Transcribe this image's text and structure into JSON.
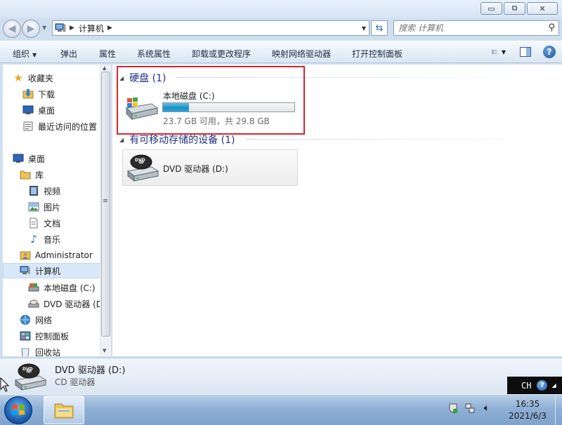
{
  "window": {
    "caption_buttons": {
      "minimize": "▭",
      "maximize": "⧉",
      "close": "✕"
    }
  },
  "address": {
    "crumbs": [
      "计算机"
    ],
    "search_placeholder": "搜索 计算机"
  },
  "toolbar": {
    "organize": "组织",
    "eject": "弹出",
    "properties": "属性",
    "system_properties": "系统属性",
    "uninstall": "卸载或更改程序",
    "map_drive": "映射网络驱动器",
    "control_panel": "打开控制面板"
  },
  "nav": {
    "favorites": "收藏夹",
    "downloads": "下载",
    "desktop_fav": "桌面",
    "recent": "最近访问的位置",
    "desktop": "桌面",
    "libraries": "库",
    "videos": "视频",
    "pictures": "图片",
    "documents": "文档",
    "music": "音乐",
    "administrator": "Administrator",
    "computer": "计算机",
    "local_disk": "本地磁盘 (C:)",
    "dvd": "DVD 驱动器 (D:)",
    "network": "网络",
    "control_panel": "控制面板",
    "recycle": "回收站"
  },
  "content": {
    "hdd_group": "硬盘 (1)",
    "removable_group": "有可移动存储的设备 (1)",
    "drive_c": {
      "name": "本地磁盘 (C:)",
      "capacity": "23.7 GB 可用，共 29.8 GB",
      "used_fraction": 0.2
    },
    "dvd": {
      "name": "DVD 驱动器 (D:)"
    }
  },
  "details": {
    "name": "DVD 驱动器 (D:)",
    "type": "CD 驱动器"
  },
  "langbar": {
    "lang": "CH",
    "help": "?"
  },
  "clock": {
    "time": "16:35",
    "date": "2021/6/3"
  }
}
